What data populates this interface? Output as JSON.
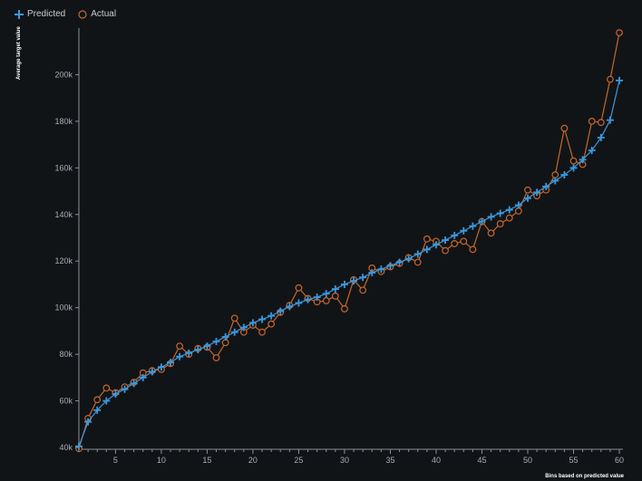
{
  "legend": {
    "predicted_label": "Predicted",
    "actual_label": "Actual"
  },
  "colors": {
    "predicted": "#3a98de",
    "actual": "#c8662a",
    "background": "#111417",
    "axis": "#8a8e94"
  },
  "chart_data": {
    "type": "line",
    "ylabel": "Average target value",
    "xlabel": "Bins based on predicted value",
    "xlim": [
      1,
      60
    ],
    "ylim": [
      40000,
      220000
    ],
    "x_ticks": [
      5,
      10,
      15,
      20,
      25,
      30,
      35,
      40,
      45,
      50,
      55,
      60
    ],
    "y_ticks": [
      40000,
      60000,
      80000,
      100000,
      120000,
      140000,
      160000,
      180000,
      200000
    ],
    "y_tick_labels": [
      "40k",
      "60k",
      "80k",
      "100k",
      "120k",
      "140k",
      "160k",
      "180k",
      "200k"
    ],
    "x": [
      1,
      2,
      3,
      4,
      5,
      6,
      7,
      8,
      9,
      10,
      11,
      12,
      13,
      14,
      15,
      16,
      17,
      18,
      19,
      20,
      21,
      22,
      23,
      24,
      25,
      26,
      27,
      28,
      29,
      30,
      31,
      32,
      33,
      34,
      35,
      36,
      37,
      38,
      39,
      40,
      41,
      42,
      43,
      44,
      45,
      46,
      47,
      48,
      49,
      50,
      51,
      52,
      53,
      54,
      55,
      56,
      57,
      58,
      59,
      60
    ],
    "series": [
      {
        "name": "Predicted",
        "marker": "plus",
        "values": [
          40500,
          51000,
          56000,
          60000,
          63000,
          65000,
          67500,
          70000,
          72500,
          74500,
          76500,
          79000,
          80500,
          82000,
          83500,
          85500,
          87500,
          89500,
          91500,
          93500,
          95000,
          96500,
          98500,
          100500,
          102000,
          103500,
          104500,
          106000,
          108000,
          110000,
          111500,
          113000,
          115000,
          116500,
          118000,
          119500,
          121000,
          123000,
          125000,
          127000,
          129000,
          131000,
          133000,
          135000,
          137000,
          139000,
          140500,
          142000,
          144000,
          147000,
          149500,
          152000,
          154500,
          157000,
          160000,
          163500,
          167500,
          173000,
          180500,
          197500
        ]
      },
      {
        "name": "Actual",
        "marker": "circle",
        "values": [
          39500,
          52500,
          60500,
          65500,
          63500,
          66000,
          68000,
          72000,
          73000,
          73500,
          76000,
          83500,
          80000,
          82500,
          83000,
          78500,
          85000,
          95500,
          89500,
          92500,
          89500,
          93000,
          98000,
          101000,
          108500,
          104000,
          102500,
          103000,
          105000,
          99500,
          112000,
          107500,
          117000,
          115500,
          117500,
          119000,
          121500,
          119500,
          129500,
          128500,
          124500,
          127500,
          128500,
          125000,
          137000,
          132000,
          136000,
          138500,
          141500,
          150500,
          148000,
          150500,
          157000,
          177000,
          163000,
          161500,
          180000,
          179500,
          198000,
          218000
        ]
      }
    ]
  }
}
